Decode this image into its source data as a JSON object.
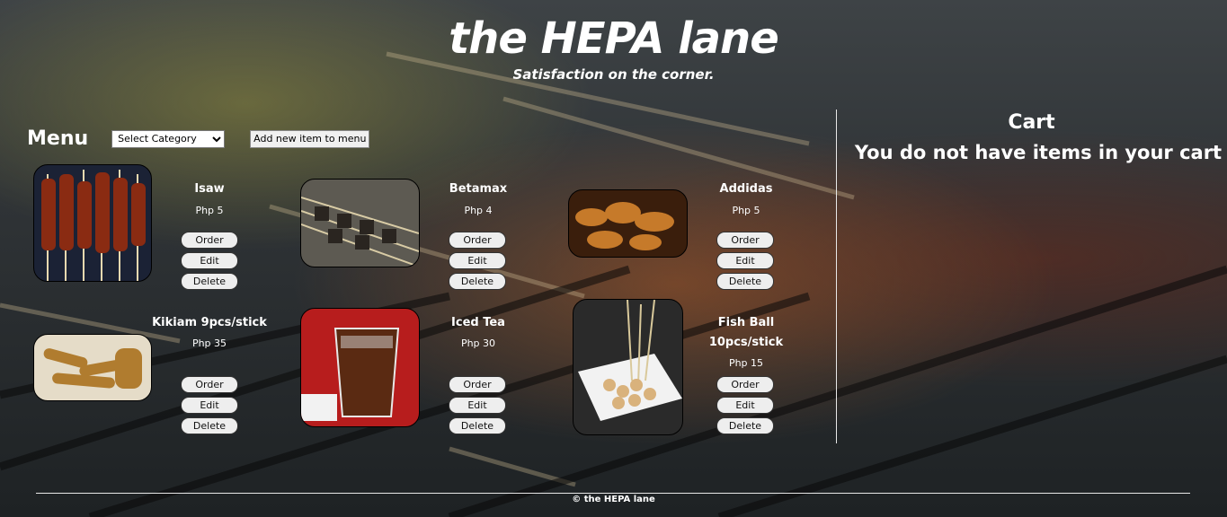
{
  "header": {
    "title": "the HEPA lane",
    "tagline": "Satisfaction on the corner."
  },
  "menu": {
    "heading": "Menu",
    "category_select": "Select Category",
    "add_button": "Add new item to menu",
    "items": [
      {
        "name": "Isaw",
        "price": "Php 5",
        "order": "Order",
        "edit": "Edit",
        "delete": "Delete"
      },
      {
        "name": "Betamax",
        "price": "Php 4",
        "order": "Order",
        "edit": "Edit",
        "delete": "Delete"
      },
      {
        "name": "Addidas",
        "price": "Php 5",
        "order": "Order",
        "edit": "Edit",
        "delete": "Delete"
      },
      {
        "name": "Kikiam 9pcs/stick",
        "price": "Php 35",
        "order": "Order",
        "edit": "Edit",
        "delete": "Delete"
      },
      {
        "name": "Iced Tea",
        "price": "Php 30",
        "order": "Order",
        "edit": "Edit",
        "delete": "Delete"
      },
      {
        "name_line1": "Fish Ball",
        "name_line2": "10pcs/stick",
        "price": "Php 15",
        "order": "Order",
        "edit": "Edit",
        "delete": "Delete"
      }
    ]
  },
  "cart": {
    "title": "Cart",
    "empty_message": "You do not have items in your cart"
  },
  "footer": {
    "text": "© the HEPA lane"
  }
}
